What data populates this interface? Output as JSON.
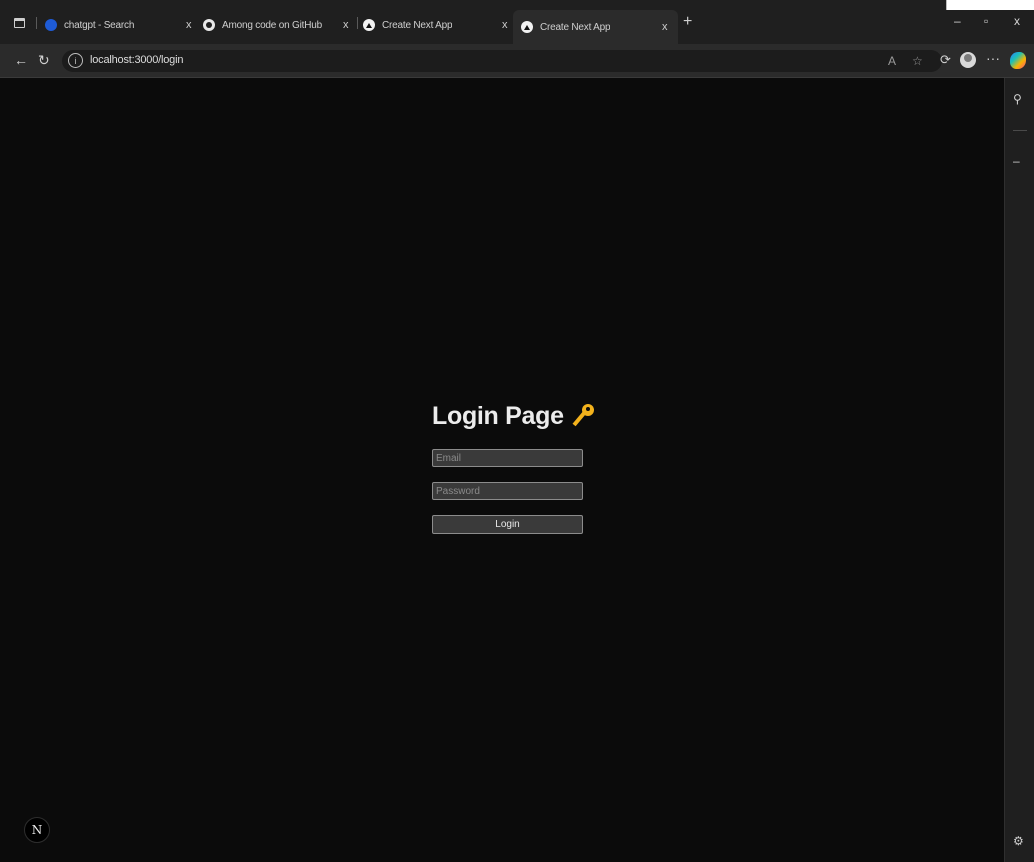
{
  "browser": {
    "tabs": [
      {
        "label": "chatgpt - Search",
        "favicon": "bing-search-icon",
        "active": false
      },
      {
        "label": "Among code on GitHub",
        "favicon": "github-icon",
        "active": false
      },
      {
        "label": "Create Next App",
        "favicon": "next-app-icon",
        "active": false
      },
      {
        "label": "Create Next App",
        "favicon": "next-app-icon",
        "active": true
      }
    ],
    "close_glyph": "x",
    "new_tab_glyph": "+",
    "window_controls": {
      "minimize": "–",
      "restore": "▫",
      "close": "x"
    },
    "url": "localhost:3000/login",
    "info_glyph": "i",
    "omnibox_icons": [
      "read-aloud-icon",
      "favorite-star-icon"
    ],
    "toolbar_icons": [
      "extensions-icon",
      "profile-avatar-icon",
      "more-options-icon",
      "copilot-icon"
    ],
    "more_glyph": "···"
  },
  "sidebar": {
    "icons": [
      "search-icon",
      "minus-icon",
      "settings-icon"
    ],
    "search_glyph": "⚲",
    "minus_glyph": "–",
    "settings_glyph": "⚙"
  },
  "page": {
    "title": "Login Page",
    "title_icon": "key-emoji-icon",
    "email_placeholder": "Email",
    "password_placeholder": "Password",
    "login_label": "Login",
    "next_badge": "N"
  },
  "colors": {
    "page_background": "#0b0b0b",
    "tab_strip": "#1f1f1f",
    "toolbar": "#2b2b2b",
    "key_accent": "#f3b21c"
  }
}
